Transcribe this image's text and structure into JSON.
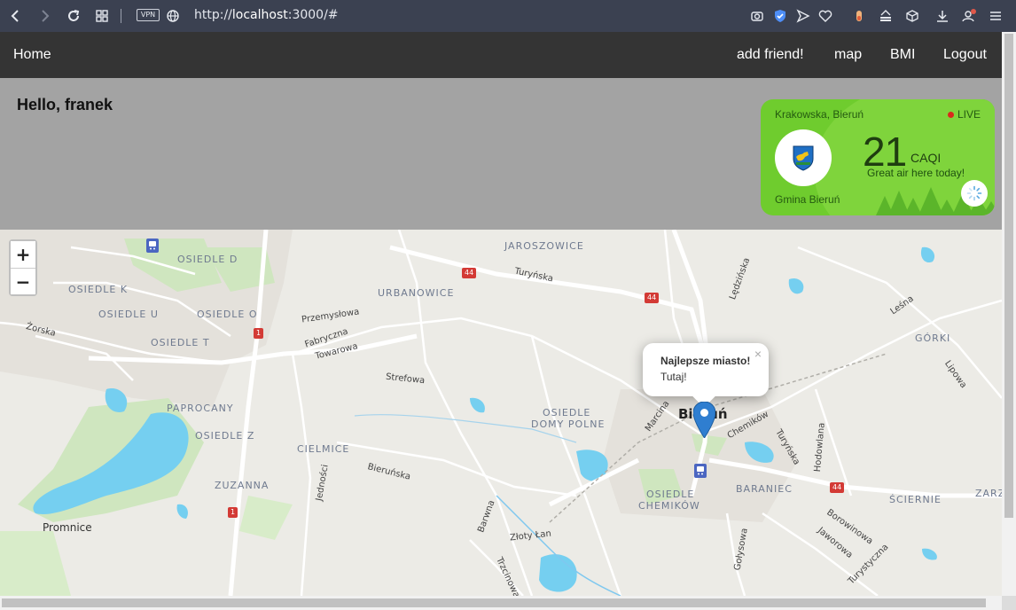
{
  "browser": {
    "vpn_label": "VPN",
    "url_prefix": "http://",
    "url_host": "localhost",
    "url_rest": ":3000/#"
  },
  "navbar": {
    "home": "Home",
    "add_friend": "add friend!",
    "map": "map",
    "bmi": "BMI",
    "logout": "Logout"
  },
  "greeting": "Hello, franek",
  "air": {
    "location": "Krakowska, Bieruń",
    "live": "LIVE",
    "value": "21",
    "unit": "CAQI",
    "message": "Great air here today!",
    "municipality": "Gmina Bieruń",
    "colors": {
      "background": "#6fcc2e",
      "live_dot": "#d9291c"
    }
  },
  "map": {
    "zoom_in": "+",
    "zoom_out": "−",
    "popup": {
      "title": "Najlepsze miasto!",
      "text": "Tutaj!",
      "close": "×"
    },
    "districts": [
      "JAROSZOWICE",
      "URBANOWICE",
      "OSIEDLE D",
      "OSIEDLE K",
      "OSIEDLE U",
      "OSIEDLE O",
      "OSIEDLE T",
      "PAPROCANY",
      "OSIEDLE Z",
      "ZUZANNA",
      "CIELMICE",
      "OSIEDLE",
      "DOMY POLNE",
      "GÓRKI",
      "OSIEDLE",
      "CHEMIKÓW",
      "BARANIEC",
      "ŚCIERNIE",
      "ZARZ"
    ],
    "streets": [
      "Turyńska",
      "Lędzińska",
      "Przemysłowa",
      "Fabryczna",
      "Towarowa",
      "Strefowa",
      "Bieruńska",
      "Jedności",
      "Marcina",
      "Chemików",
      "Turyńska",
      "Hodowlana",
      "Leśna",
      "Lipowa",
      "Barwna",
      "Złoty Łan",
      "Trzcinowa",
      "Gołysowa",
      "Borowinowa",
      "Jaworowa",
      "Turystyczna",
      "Żorska"
    ],
    "towns": [
      "Promnice",
      "Bieruń"
    ],
    "road_numbers": [
      "44",
      "44",
      "1",
      "1",
      "44"
    ]
  }
}
